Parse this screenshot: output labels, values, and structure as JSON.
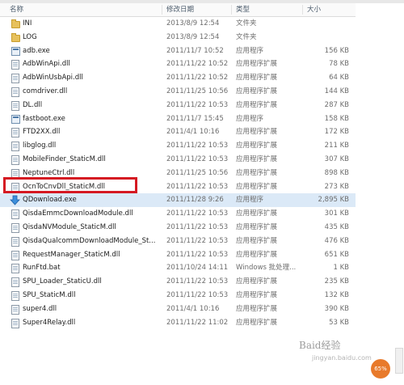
{
  "columns": {
    "name": "名称",
    "date": "修改日期",
    "type": "类型",
    "size": "大小"
  },
  "files": [
    {
      "name": "INI",
      "date": "2013/8/9 12:54",
      "type": "文件夹",
      "size": "",
      "icon": "folder-icon"
    },
    {
      "name": "LOG",
      "date": "2013/8/9 12:54",
      "type": "文件夹",
      "size": "",
      "icon": "folder-icon"
    },
    {
      "name": "adb.exe",
      "date": "2011/11/7 10:52",
      "type": "应用程序",
      "size": "156 KB",
      "icon": "exe-icon"
    },
    {
      "name": "AdbWinApi.dll",
      "date": "2011/11/22 10:52",
      "type": "应用程序扩展",
      "size": "78 KB",
      "icon": "dll-icon"
    },
    {
      "name": "AdbWinUsbApi.dll",
      "date": "2011/11/22 10:52",
      "type": "应用程序扩展",
      "size": "64 KB",
      "icon": "dll-icon"
    },
    {
      "name": "comdriver.dll",
      "date": "2011/11/25 10:56",
      "type": "应用程序扩展",
      "size": "144 KB",
      "icon": "dll-icon"
    },
    {
      "name": "DL.dll",
      "date": "2011/11/22 10:53",
      "type": "应用程序扩展",
      "size": "287 KB",
      "icon": "dll-icon"
    },
    {
      "name": "fastboot.exe",
      "date": "2011/11/7 15:45",
      "type": "应用程序",
      "size": "158 KB",
      "icon": "exe-icon"
    },
    {
      "name": "FTD2XX.dll",
      "date": "2011/4/1 10:16",
      "type": "应用程序扩展",
      "size": "172 KB",
      "icon": "dll-icon"
    },
    {
      "name": "libglog.dll",
      "date": "2011/11/22 10:53",
      "type": "应用程序扩展",
      "size": "211 KB",
      "icon": "dll-icon"
    },
    {
      "name": "MobileFinder_StaticM.dll",
      "date": "2011/11/22 10:53",
      "type": "应用程序扩展",
      "size": "307 KB",
      "icon": "dll-icon"
    },
    {
      "name": "NeptuneCtrl.dll",
      "date": "2011/11/25 10:56",
      "type": "应用程序扩展",
      "size": "898 KB",
      "icon": "dll-icon"
    },
    {
      "name": "OcnToCnvDll_StaticM.dll",
      "date": "2011/11/22 10:53",
      "type": "应用程序扩展",
      "size": "273 KB",
      "icon": "dll-icon"
    },
    {
      "name": "QDownload.exe",
      "date": "2011/11/28 9:26",
      "type": "应用程序",
      "size": "2,895 KB",
      "icon": "download-arrow-icon",
      "highlight": true
    },
    {
      "name": "QisdaEmmcDownloadModule.dll",
      "date": "2011/11/22 10:53",
      "type": "应用程序扩展",
      "size": "301 KB",
      "icon": "dll-icon"
    },
    {
      "name": "QisdaNVModule_StaticM.dll",
      "date": "2011/11/22 10:53",
      "type": "应用程序扩展",
      "size": "435 KB",
      "icon": "dll-icon"
    },
    {
      "name": "QisdaQualcommDownloadModule_St...",
      "date": "2011/11/22 10:53",
      "type": "应用程序扩展",
      "size": "476 KB",
      "icon": "dll-icon"
    },
    {
      "name": "RequestManager_StaticM.dll",
      "date": "2011/11/22 10:53",
      "type": "应用程序扩展",
      "size": "651 KB",
      "icon": "dll-icon"
    },
    {
      "name": "RunFtd.bat",
      "date": "2011/10/24 14:11",
      "type": "Windows 批处理...",
      "size": "1 KB",
      "icon": "bat-icon"
    },
    {
      "name": "SPU_Loader_StaticU.dll",
      "date": "2011/11/22 10:53",
      "type": "应用程序扩展",
      "size": "235 KB",
      "icon": "dll-icon"
    },
    {
      "name": "SPU_StaticM.dll",
      "date": "2011/11/22 10:53",
      "type": "应用程序扩展",
      "size": "132 KB",
      "icon": "dll-icon"
    },
    {
      "name": "super4.dll",
      "date": "2011/4/1 10:16",
      "type": "应用程序扩展",
      "size": "390 KB",
      "icon": "dll-icon"
    },
    {
      "name": "Super4Relay.dll",
      "date": "2011/11/22 11:02",
      "type": "应用程序扩展",
      "size": "53 KB",
      "icon": "dll-icon"
    }
  ],
  "badge": {
    "text": "65%"
  },
  "watermark": {
    "main": "Baid经验",
    "sub": "jingyan.baidu.com"
  },
  "colors": {
    "highlight_box": "#d51922",
    "folder": "#e7c15c",
    "selection": "#dbe9f7"
  }
}
